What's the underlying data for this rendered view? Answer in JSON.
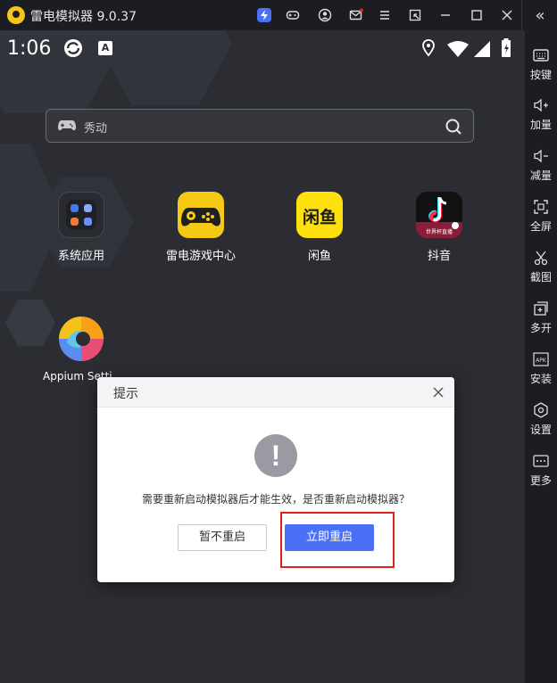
{
  "window": {
    "title": "雷电模拟器 9.0.37",
    "collapse_glyph": "«"
  },
  "sidebar": {
    "items": [
      {
        "label": "按键",
        "icon": "keyboard-icon"
      },
      {
        "label": "加量",
        "icon": "volume-up-icon"
      },
      {
        "label": "减量",
        "icon": "volume-down-icon"
      },
      {
        "label": "全屏",
        "icon": "fullscreen-icon"
      },
      {
        "label": "截图",
        "icon": "scissors-icon"
      },
      {
        "label": "多开",
        "icon": "multi-instance-icon"
      },
      {
        "label": "安装",
        "icon": "apk-install-icon"
      },
      {
        "label": "设置",
        "icon": "settings-icon"
      },
      {
        "label": "更多",
        "icon": "more-icon"
      }
    ]
  },
  "statusbar": {
    "time": "1:06",
    "keyboard_badge": "A"
  },
  "search": {
    "placeholder": "秀动"
  },
  "apps": [
    {
      "label": "系统应用",
      "icon": "system-apps-icon"
    },
    {
      "label": "雷电游戏中心",
      "icon": "game-center-icon"
    },
    {
      "label": "闲鱼",
      "icon": "xianyu-icon",
      "icon_text": "闲鱼"
    },
    {
      "label": "抖音",
      "icon": "douyin-icon",
      "icon_text": "世界杯直播"
    },
    {
      "label": "Appium Setti",
      "icon": "appium-icon"
    }
  ],
  "dialog": {
    "title": "提示",
    "warning_glyph": "!",
    "message": "需要重新启动模拟器后才能生效，是否重新启动模拟器？",
    "cancel_label": "暂不重启",
    "confirm_label": "立即重启"
  },
  "colors": {
    "accent": "#4b70f5",
    "highlight": "#e0221f",
    "titlebar": "#1c1d22",
    "desktop": "#2b2d33"
  }
}
